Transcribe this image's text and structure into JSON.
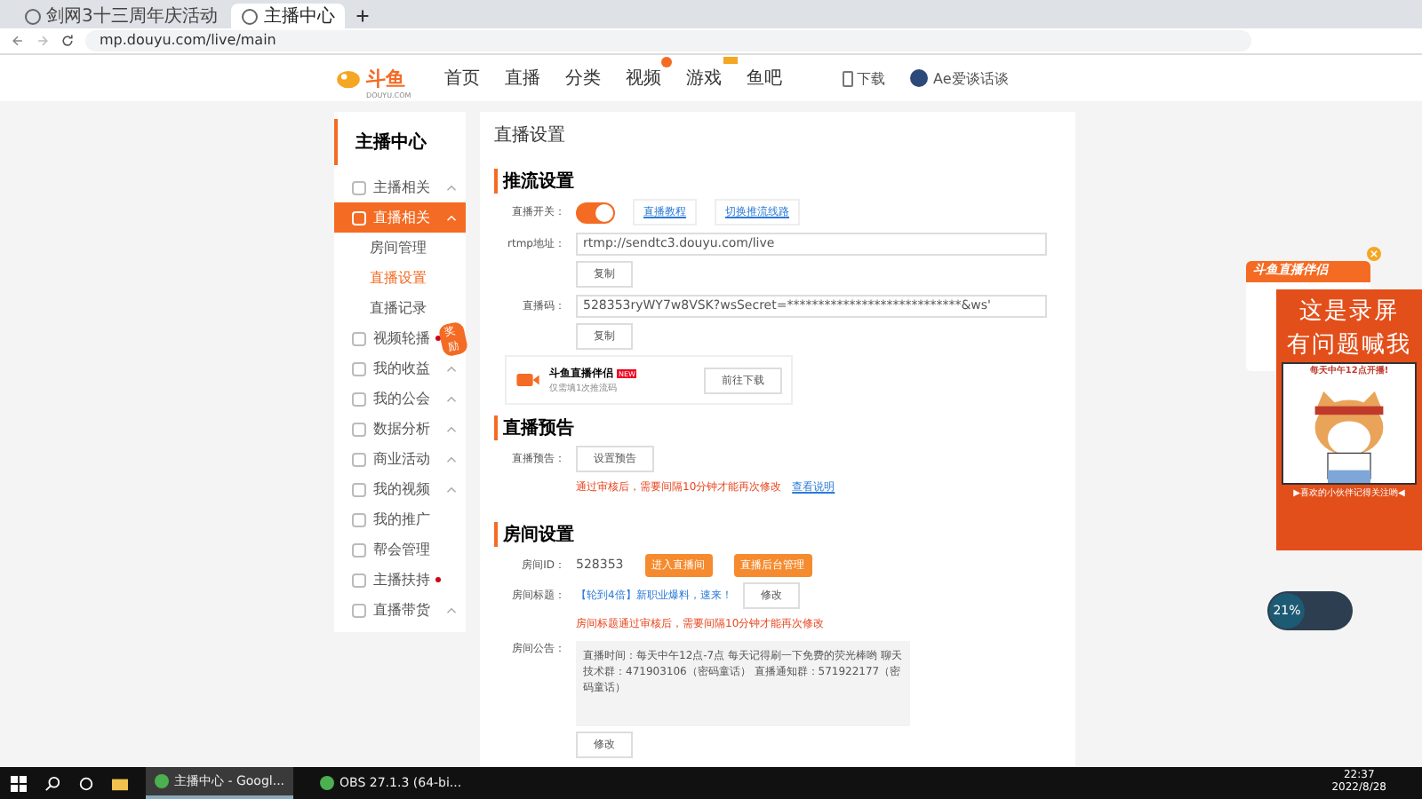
{
  "browser": {
    "tabs": [
      {
        "title": "剑网3十三周年庆活动",
        "selected": false
      },
      {
        "title": "主播中心",
        "selected": true
      }
    ],
    "url": "mp.douyu.com/live/main"
  },
  "site_header": {
    "logo": "斗鱼",
    "logo_sub": "DOUYU.COM",
    "nav": [
      {
        "label": "首页",
        "hot": false,
        "tagged": false
      },
      {
        "label": "直播",
        "hot": false,
        "tagged": false
      },
      {
        "label": "分类",
        "hot": false,
        "tagged": false
      },
      {
        "label": "视频",
        "hot": true,
        "tagged": false
      },
      {
        "label": "游戏",
        "hot": false,
        "tagged": true
      },
      {
        "label": "鱼吧",
        "hot": false,
        "tagged": false
      }
    ],
    "download": "下载",
    "user": "Ae爱谈话谈"
  },
  "sidebar": {
    "title": "主播中心",
    "items": [
      {
        "label": "主播相关",
        "caret": true,
        "selected": false,
        "dot": false
      },
      {
        "label": "直播相关",
        "caret": true,
        "selected": true,
        "dot": false,
        "children": [
          {
            "label": "房间管理",
            "selected": false
          },
          {
            "label": "直播设置",
            "selected": true
          },
          {
            "label": "直播记录",
            "selected": false
          }
        ]
      },
      {
        "label": "视频轮播",
        "caret": false,
        "selected": false,
        "dot": true,
        "badge": "奖励"
      },
      {
        "label": "我的收益",
        "caret": true,
        "selected": false,
        "dot": false
      },
      {
        "label": "我的公会",
        "caret": true,
        "selected": false,
        "dot": false
      },
      {
        "label": "数据分析",
        "caret": true,
        "selected": false,
        "dot": false
      },
      {
        "label": "商业活动",
        "caret": true,
        "selected": false,
        "dot": false
      },
      {
        "label": "我的视频",
        "caret": true,
        "selected": false,
        "dot": false
      },
      {
        "label": "我的推广",
        "caret": false,
        "selected": false,
        "dot": false
      },
      {
        "label": "帮会管理",
        "caret": false,
        "selected": false,
        "dot": false
      },
      {
        "label": "主播扶持",
        "caret": false,
        "selected": false,
        "dot": true
      },
      {
        "label": "直播带货",
        "caret": true,
        "selected": false,
        "dot": false
      }
    ]
  },
  "main": {
    "title": "直播设置",
    "push": {
      "heading": "推流设置",
      "switch_label": "直播开关：",
      "switch_on": true,
      "links": [
        "直播教程",
        "切换推流线路"
      ],
      "rtmp_label": "rtmp地址：",
      "rtmp_value": "rtmp://sendtc3.douyu.com/live",
      "rtmp_button": "复制",
      "code_label": "直播码：",
      "code_value": "528353ryWY7w8VSK?wsSecret=****************************&ws'",
      "code_button": "复制",
      "companion": {
        "name": "斗鱼直播伴侣",
        "tag": "NEW",
        "desc": "仅需填1次推流码",
        "button": "前往下载"
      }
    },
    "notice": {
      "heading": "直播预告",
      "label": "直播预告：",
      "button": "设置预告",
      "warning": "通过审核后，需要间隔10分钟才能再次修改",
      "link": "查看说明"
    },
    "room": {
      "heading": "房间设置",
      "id_label": "房间ID：",
      "id": "528353",
      "buttons": [
        "进入直播间",
        "直播后台管理"
      ],
      "title_label": "房间标题：",
      "title_value": "【轮到4倍】新职业爆料，速来！",
      "title_button": "修改",
      "title_warning": "房间标题通过审核后，需要间隔10分钟才能再次修改",
      "announce_label": "房间公告：",
      "announce_value": "直播时间：每天中午12点-7点 每天记得刷一下免费的荧光棒哟 聊天技术群：471903106（密码童话） 直播通知群：571922177（密码童话）",
      "announce_button": "修改"
    }
  },
  "popup": {
    "title": "斗鱼直播伴侣"
  },
  "ad": {
    "line1": "这是录屏",
    "line2": "有问题喊我",
    "caption_top": "每天中午12点开播!",
    "caption_bottom": "▶喜欢的小伙伴记得关注哟◀"
  },
  "widget": {
    "percent": "21%"
  },
  "taskbar": {
    "apps": [
      {
        "label": "主播中心 - Googl...",
        "selected": true
      },
      {
        "label": "OBS 27.1.3 (64-bi...",
        "selected": false
      }
    ],
    "time": "22:37",
    "date": "2022/8/28"
  }
}
